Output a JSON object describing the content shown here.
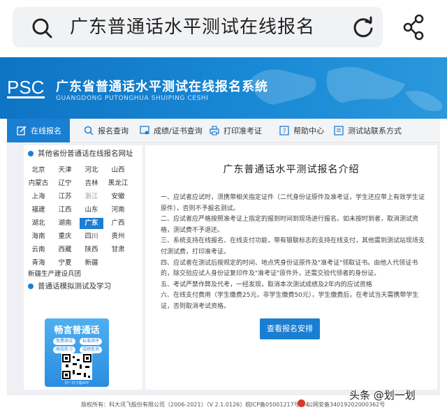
{
  "search": {
    "query": "广东普通话水平测试在线报名"
  },
  "banner": {
    "logo": "PSC",
    "title": "广东省普通话水平测试在线报名系统",
    "subtitle": "GUANGDONG PUTONGHUA SHUIPING CESHI"
  },
  "nav": [
    {
      "label": "在线报名",
      "icon": "edit-icon"
    },
    {
      "label": "报名查询",
      "icon": "search-icon"
    },
    {
      "label": "成绩/证书查询",
      "icon": "certificate-icon"
    },
    {
      "label": "打印准考证",
      "icon": "printer-icon"
    },
    {
      "label": "帮助中心",
      "icon": "help-icon"
    },
    {
      "label": "测试站联系方式",
      "icon": "contact-icon"
    }
  ],
  "sidebar": {
    "section1_title": "其他省份普通话在线报名网址",
    "provinces": [
      "北京",
      "天津",
      "河北",
      "山西",
      "内蒙古",
      "辽宁",
      "吉林",
      "黑龙江",
      "上海",
      "江苏",
      "浙江",
      "安徽",
      "福建",
      "江西",
      "山东",
      "河南",
      "湖北",
      "湖南",
      "广东",
      "广西",
      "海南",
      "重庆",
      "四川",
      "贵州",
      "云南",
      "西藏",
      "陕西",
      "甘肃",
      "青海",
      "宁夏",
      "新疆"
    ],
    "active_province": "广东",
    "dim_province": "浙江",
    "xinjiang_link": "新疆生产建设兵团",
    "section2_title": "普通话模拟测试及学习",
    "promo": {
      "title": "畅言普通话",
      "tags": [
        "免费测试",
        "标准测评",
        "高效练习",
        "成绩查询"
      ],
      "footer": "扫一扫下载APP"
    }
  },
  "main": {
    "title": "广东普通话水平测试报名介绍",
    "rules": [
      "一、应试者应试时，须携带相关指定证件（二代身份证原件及准考证，学生还应带上有效学生证原件），否则不予报名测试。",
      "二、应试者应严格按照准考证上指定的报到时间到现场进行报名。如未按时到者，取消测试资格，测试费不予退还。",
      "三、系统支持在线报名、在线支付功能，带有银联标志的支持在线支付，其他需到测试站现场支付测试费，打印准考证。",
      "四、应试者在测试后按规定的时间、地点凭身份证原件及\"准考证\"领取证书。由他人代领证书的，除交验应试人身份证复印件及\"准考证\"原件外，还需交验代领者的身份证。",
      "五、考试严禁作弊及代考，一经发现，取消本次测试成绩及2年内的应试资格",
      "六、在线支付费用（学生缴费25元，非学生缴费50元），学生缴费后，在考试当天需携带学生证，否则取消考试资格。"
    ],
    "button": "查看报名安排"
  },
  "footer": {
    "copyright": "版权所有：科大讯飞股份有限公司（2006-2021）（V 2.1.0126）皖ICP备05001217号-24",
    "police": "公网安备34019202000362号"
  },
  "watermark": "头条 @划一划"
}
